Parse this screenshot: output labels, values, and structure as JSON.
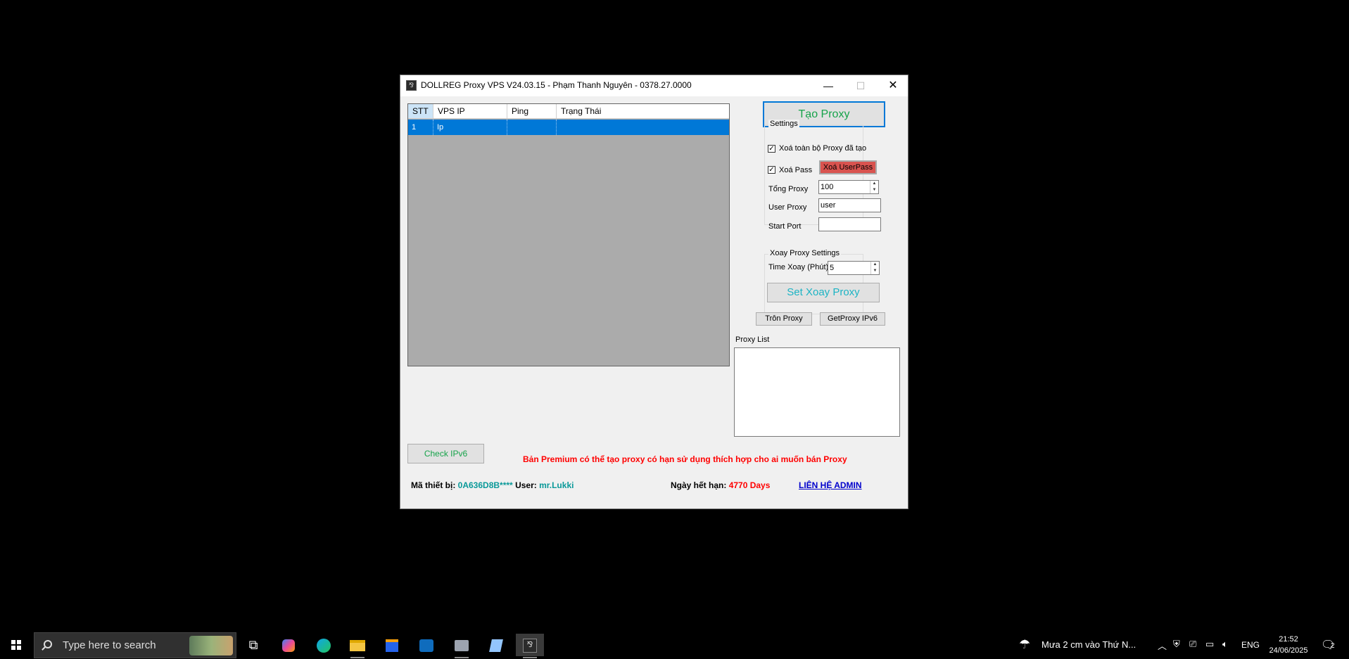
{
  "window": {
    "title": "DOLLREG Proxy VPS V24.03.15  - Phạm Thanh Nguyên - 0378.27.0000",
    "controls": {
      "minimize": "—",
      "maximize": "☐",
      "close": "✕"
    }
  },
  "grid": {
    "columns": [
      "STT",
      "VPS IP",
      "Ping",
      "Trạng Thái"
    ],
    "rows": [
      {
        "stt": "1",
        "ip": "Ip",
        "ping": "",
        "status": ""
      }
    ]
  },
  "buttons": {
    "tao_proxy": "Tạo Proxy",
    "xoa_userpass": "Xoá UserPass",
    "set_xoay": "Set Xoay Proxy",
    "tron_proxy": "Trôn Proxy",
    "get_ipv6": "GetProxy IPv6",
    "check_ipv6": "Check IPv6"
  },
  "settings": {
    "title": "Settings",
    "xoa_toan_bo": "Xoá toàn bộ Proxy đã tạo",
    "xoa_toan_bo_checked": true,
    "xoa_pass": "Xoá Pass",
    "xoa_pass_checked": true,
    "tong_proxy_label": "Tổng Proxy",
    "tong_proxy_value": "100",
    "user_proxy_label": "User Proxy",
    "user_proxy_value": "user",
    "start_port_label": "Start Port",
    "start_port_value": ""
  },
  "xoay": {
    "title": "Xoay Proxy Settings",
    "time_label": "Time Xoay (Phút)",
    "time_value": "5"
  },
  "proxy_list": {
    "label": "Proxy List",
    "value": ""
  },
  "footer": {
    "premium": "Bản Premium có thể tạo proxy có hạn sử dụng thích hợp cho ai muốn bán Proxy",
    "device_label": "Mã thiết bị:",
    "device_value": "0A636D8B****",
    "user_label": "User:",
    "user_value": "mr.Lukki",
    "expiry_label": "Ngày hết hạn:",
    "expiry_value": "4770 Days",
    "contact": "LIÊN HỆ ADMIN "
  },
  "taskbar": {
    "search_placeholder": "Type here to search",
    "weather": "Mưa 2 cm vào Thứ N...",
    "lang": "ENG",
    "time": "21:52",
    "date": "24/06/2025",
    "notif_count": "2"
  },
  "colors": {
    "accent": "#0078d7",
    "green": "#16a34a",
    "teal": "#0a9999",
    "red": "#ff0000",
    "xoa_btn": "#d9534f"
  }
}
